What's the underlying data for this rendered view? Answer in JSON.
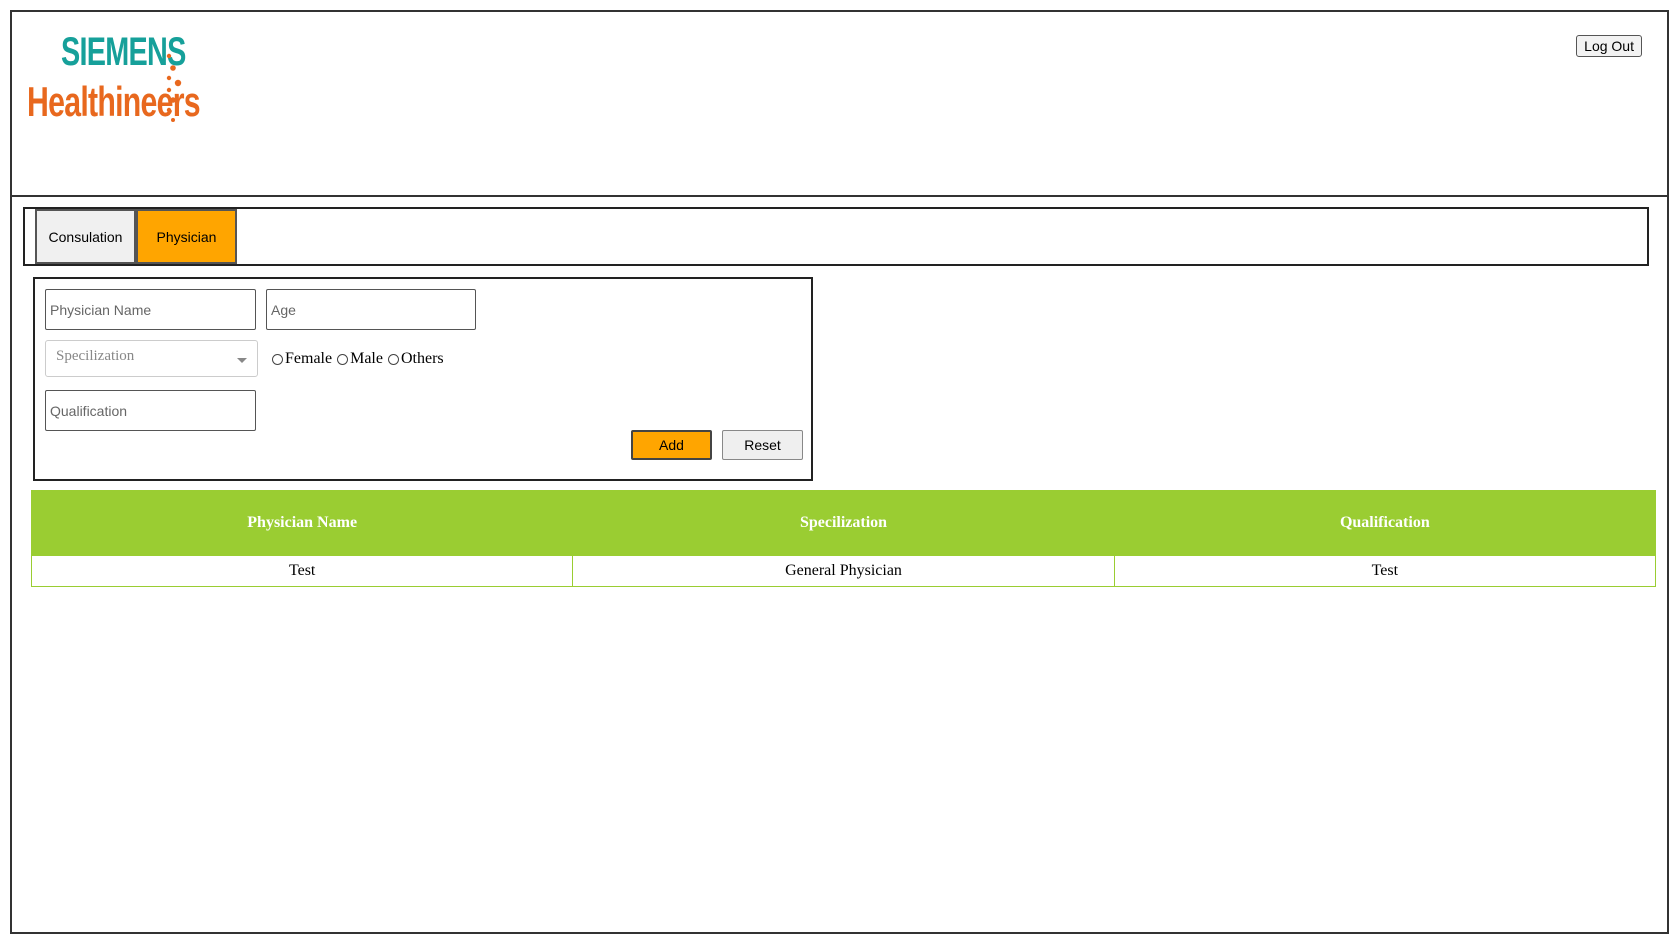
{
  "header": {
    "logo_line1": "SIEMENS",
    "logo_line2": "Healthineers",
    "logout_label": "Log Out"
  },
  "tabs": [
    {
      "label": "Consulation",
      "active": false
    },
    {
      "label": "Physician",
      "active": true
    }
  ],
  "form": {
    "name_placeholder": "Physician Name",
    "age_placeholder": "Age",
    "specialization_selected": "Specilization",
    "gender_options": [
      "Female",
      "Male",
      "Others"
    ],
    "qualification_placeholder": "Qualification",
    "add_label": "Add",
    "reset_label": "Reset"
  },
  "table": {
    "columns": [
      "Physician Name",
      "Specilization",
      "Qualification"
    ],
    "rows": [
      [
        "Test",
        "General Physician",
        "Test"
      ]
    ]
  },
  "colors": {
    "accent": "#ffa500",
    "table_header": "#9acd32",
    "brand_teal": "#16a09a",
    "brand_orange": "#e8681e"
  }
}
